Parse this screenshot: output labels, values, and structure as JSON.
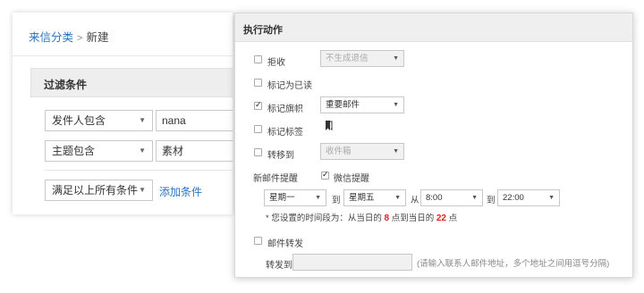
{
  "breadcrumb": {
    "parent": "来信分类",
    "separator": ">",
    "current": "新建"
  },
  "filter": {
    "section_title": "过滤条件",
    "conditions": [
      {
        "field": "发件人包含",
        "value": "nana"
      },
      {
        "field": "主题包含",
        "value": "素材"
      }
    ],
    "match_mode": "满足以上所有条件",
    "add_condition_label": "添加条件"
  },
  "actions": {
    "section_title": "执行动作",
    "reject": {
      "label": "拒收",
      "checked": false,
      "option": "不生成退信"
    },
    "mark_read": {
      "label": "标记为已读",
      "checked": false
    },
    "mark_flag": {
      "label": "标记旗帜",
      "checked": true,
      "option": "重要邮件"
    },
    "mark_tag": {
      "label": "标记标签",
      "checked": false
    },
    "move_to": {
      "label": "转移到",
      "checked": false,
      "option": "收件箱"
    },
    "new_mail_alert": {
      "label": "新邮件提醒",
      "wechat_label": "微信提醒",
      "wechat_checked": true
    },
    "schedule": {
      "day_from": "星期一",
      "to_word_1": "到",
      "day_to": "星期五",
      "from_word": "从",
      "time_from": "8:00",
      "to_word_2": "到",
      "time_to": "22:00"
    },
    "schedule_summary": {
      "prefix": "* 您设置的时间段为：从当日的",
      "start_hour": "8",
      "middle": "点到当日的",
      "end_hour": "22",
      "suffix": "点"
    },
    "forward": {
      "label": "邮件转发",
      "checked": false,
      "to_label": "转发到",
      "hint": "(请输入联系人邮件地址，多个地址之间用逗号分隔)"
    }
  }
}
